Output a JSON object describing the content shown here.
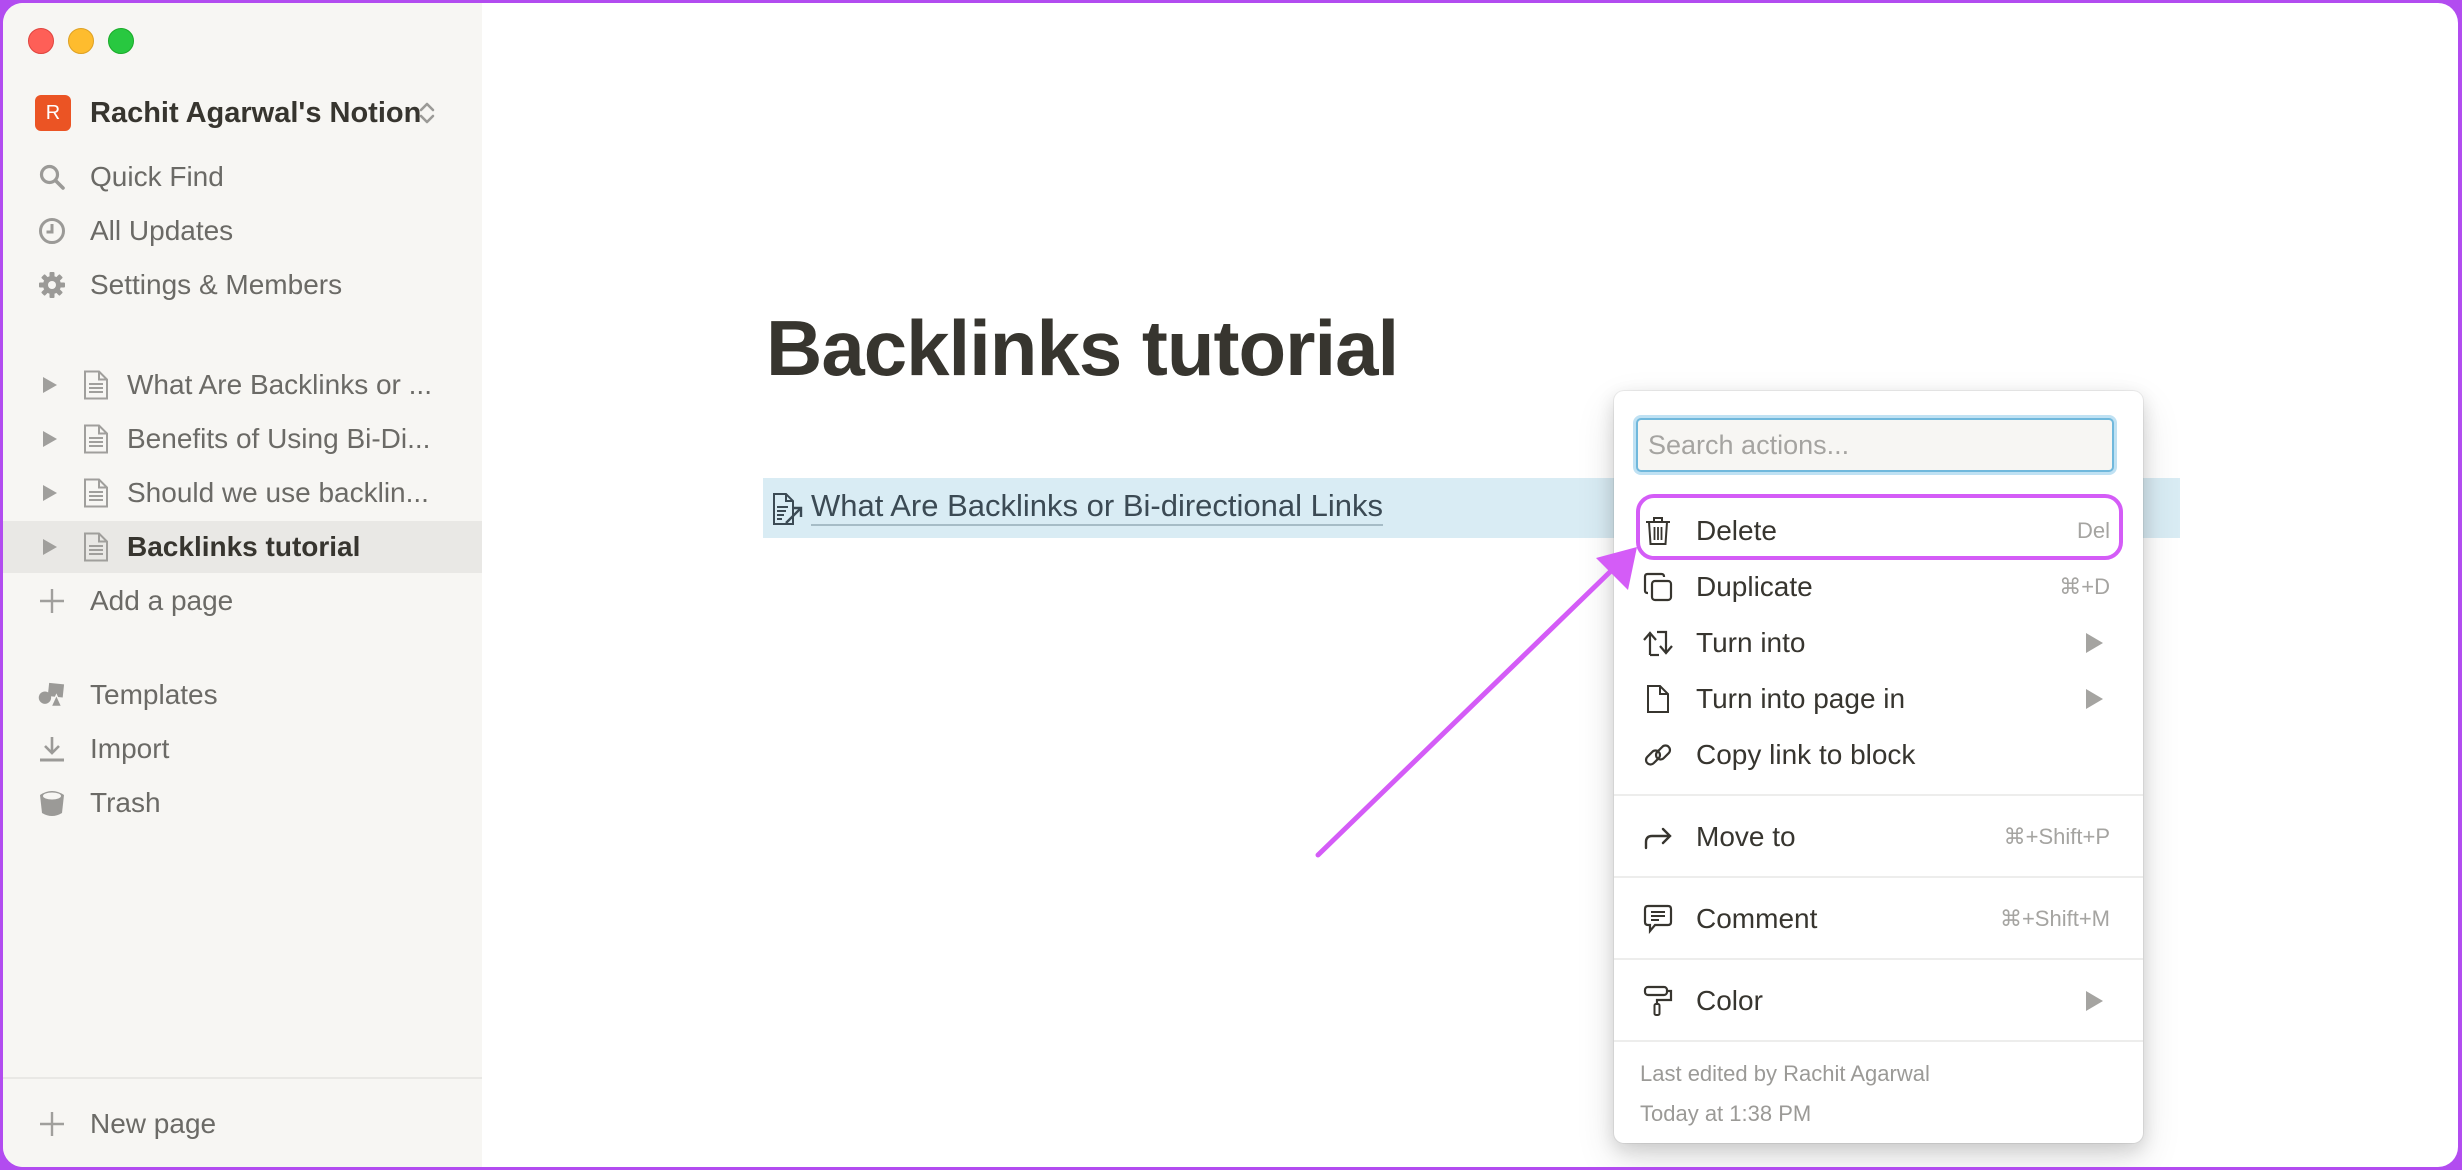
{
  "app": {
    "name": "Notion"
  },
  "sidebar": {
    "workspace": {
      "avatar_letter": "R",
      "name": "Rachit Agarwal's Notion",
      "avatar_color": "#eb5424"
    },
    "nav": [
      {
        "label": "Quick Find",
        "icon": "search-icon"
      },
      {
        "label": "All Updates",
        "icon": "clock-icon"
      },
      {
        "label": "Settings & Members",
        "icon": "gear-icon"
      }
    ],
    "pages": [
      {
        "label": "What Are Backlinks or ...",
        "selected": false
      },
      {
        "label": "Benefits of Using Bi-Di...",
        "selected": false
      },
      {
        "label": "Should we use backlin...",
        "selected": false
      },
      {
        "label": "Backlinks tutorial",
        "selected": true
      }
    ],
    "add_page_label": "Add a page",
    "tools": [
      {
        "label": "Templates",
        "icon": "templates-icon"
      },
      {
        "label": "Import",
        "icon": "import-icon"
      },
      {
        "label": "Trash",
        "icon": "trash-icon"
      }
    ],
    "new_page_label": "New page"
  },
  "page": {
    "title": "Backlinks tutorial",
    "link_block_text": "What Are Backlinks or Bi-directional Links",
    "highlight_color": "#d9ecf4"
  },
  "context_menu": {
    "search_placeholder": "Search actions...",
    "search_value": "",
    "items": [
      {
        "label": "Delete",
        "shortcut": "Del",
        "icon": "trash-icon",
        "submenu": false,
        "highlighted": true
      },
      {
        "label": "Duplicate",
        "shortcut": "⌘+D",
        "icon": "duplicate-icon",
        "submenu": false
      },
      {
        "label": "Turn into",
        "shortcut": "",
        "icon": "turn-into-icon",
        "submenu": true
      },
      {
        "label": "Turn into page in",
        "shortcut": "",
        "icon": "page-icon",
        "submenu": true
      },
      {
        "label": "Copy link to block",
        "shortcut": "",
        "icon": "link-icon",
        "submenu": false
      },
      {
        "label": "Move to",
        "shortcut": "⌘+Shift+P",
        "icon": "move-arrow-icon",
        "submenu": false
      },
      {
        "label": "Comment",
        "shortcut": "⌘+Shift+M",
        "icon": "comment-icon",
        "submenu": false
      },
      {
        "label": "Color",
        "shortcut": "",
        "icon": "paint-roller-icon",
        "submenu": true
      }
    ],
    "footer": {
      "last_edited_by": "Last edited by Rachit Agarwal",
      "last_edited_time": "Today at 1:38 PM"
    }
  },
  "annotation": {
    "color": "#d45cf7"
  }
}
